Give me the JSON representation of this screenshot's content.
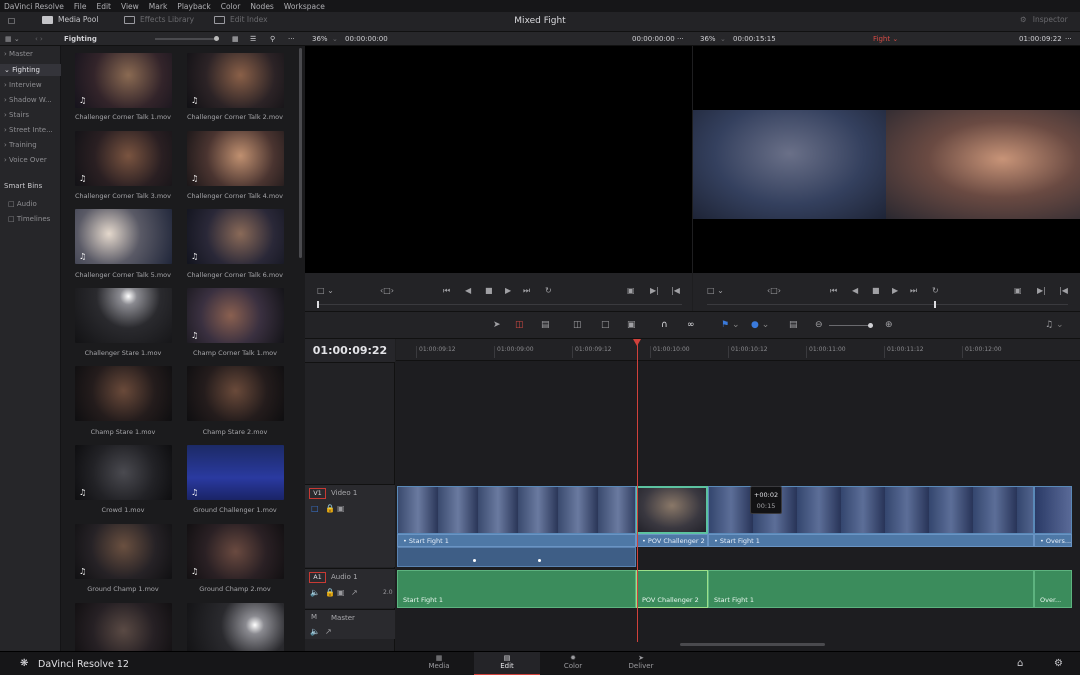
{
  "menu": [
    "DaVinci Resolve",
    "File",
    "Edit",
    "View",
    "Mark",
    "Playback",
    "Color",
    "Nodes",
    "Workspace"
  ],
  "toolbar": {
    "media_pool": "Media Pool",
    "effects_library": "Effects Library",
    "edit_index": "Edit Index",
    "project_title": "Mixed Fight",
    "inspector": "Inspector"
  },
  "pool": {
    "bin_title": "Fighting"
  },
  "viewer_left": {
    "zoom": "36%",
    "timecode_in": "00:00:00:00",
    "timecode_out": "00:00:00:00"
  },
  "viewer_right": {
    "zoom": "36%",
    "timecode_in": "00:00:15:15",
    "timeline_name": "Fight",
    "timecode_out": "01:00:09:22"
  },
  "bins": {
    "items": [
      "Master",
      "Fighting",
      "Interview",
      "Shadow W...",
      "Stairs",
      "Street Inte...",
      "Training",
      "Voice Over"
    ],
    "smart_bins_header": "Smart Bins",
    "smart_items": [
      "Audio",
      "Timelines"
    ]
  },
  "clips": [
    "Challenger Corner Talk 1.mov",
    "Challenger Corner Talk 2.mov",
    "Challenger Corner Talk 3.mov",
    "Challenger Corner Talk 4.mov",
    "Challenger Corner Talk 5.mov",
    "Challenger Corner Talk 6.mov",
    "Challenger Stare 1.mov",
    "Champ Corner Talk 1.mov",
    "Champ Stare 1.mov",
    "Champ Stare 2.mov",
    "Crowd 1.mov",
    "Ground Challenger 1.mov",
    "Ground Champ 1.mov",
    "Ground Champ 2.mov"
  ],
  "timeline": {
    "timecode": "01:00:09:22",
    "ruler": [
      "01:00:09:12",
      "01:00:09:00",
      "01:00:09:12",
      "01:00:10:00",
      "01:00:10:12",
      "01:00:11:00",
      "01:00:11:12",
      "01:00:12:00"
    ],
    "video_track": {
      "id": "V1",
      "name": "Video 1"
    },
    "audio_track": {
      "id": "A1",
      "name": "Audio 1",
      "level": "2.0"
    },
    "master_track": {
      "id": "M",
      "name": "Master"
    },
    "video_clips": [
      "Start Fight 1",
      "POV Challenger 2",
      "Start Fight 1",
      "Overs..."
    ],
    "audio_clips": [
      "Start Fight 1",
      "POV Challenger 2",
      "Start Fight 1",
      "Over..."
    ],
    "tooltip_offset": "+00:02",
    "tooltip_duration": "00:15"
  },
  "bottom_nav": {
    "app_name": "DaVinci Resolve 12",
    "pages": [
      "Media",
      "Edit",
      "Color",
      "Deliver"
    ],
    "active": "Edit"
  }
}
